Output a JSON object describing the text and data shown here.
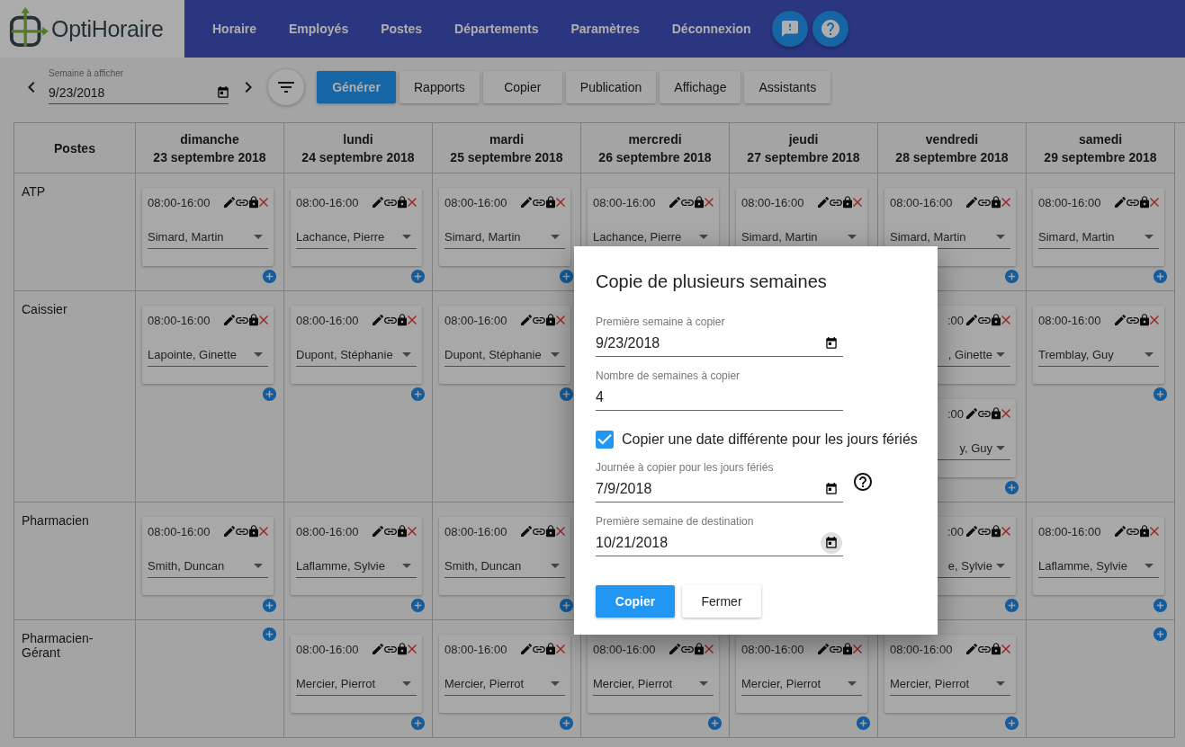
{
  "app": {
    "logo": "OptiHoraire"
  },
  "nav": [
    "Horaire",
    "Employés",
    "Postes",
    "Départements",
    "Paramètres",
    "Déconnexion"
  ],
  "week_picker": {
    "label": "Semaine à afficher",
    "value": "9/23/2018"
  },
  "actions": [
    {
      "label": "Générer",
      "primary": true
    },
    {
      "label": "Rapports",
      "primary": false
    },
    {
      "label": "Copier",
      "primary": false
    },
    {
      "label": "Publication",
      "primary": false
    },
    {
      "label": "Affichage",
      "primary": false
    },
    {
      "label": "Assistants",
      "primary": false
    }
  ],
  "schedule": {
    "corner": "Postes",
    "days": [
      {
        "name": "dimanche",
        "date": "23 septembre 2018"
      },
      {
        "name": "lundi",
        "date": "24 septembre 2018"
      },
      {
        "name": "mardi",
        "date": "25 septembre 2018"
      },
      {
        "name": "mercredi",
        "date": "26 septembre 2018"
      },
      {
        "name": "jeudi",
        "date": "27 septembre 2018"
      },
      {
        "name": "vendredi",
        "date": "28 septembre 2018"
      },
      {
        "name": "samedi",
        "date": "29 septembre 2018"
      }
    ],
    "rows": [
      {
        "post": "ATP",
        "cells": [
          {
            "add_button": true,
            "shifts": [
              {
                "time": "08:00-16:00",
                "employee": "Simard, Martin"
              }
            ]
          },
          {
            "add_button": true,
            "shifts": [
              {
                "time": "08:00-16:00",
                "employee": "Lachance, Pierre"
              }
            ]
          },
          {
            "add_button": true,
            "shifts": [
              {
                "time": "08:00-16:00",
                "employee": "Simard, Martin"
              }
            ]
          },
          {
            "shifts": [
              {
                "time": "08:00-16:00",
                "employee": "Lachance, Pierre"
              }
            ]
          },
          {
            "shifts": [
              {
                "time": "08:00-16:00",
                "employee": "Simard, Martin"
              }
            ]
          },
          {
            "add_button": true,
            "shifts": [
              {
                "time": "08:00-16:00",
                "employee": "Simard, Martin"
              }
            ]
          },
          {
            "add_button": true,
            "shifts": [
              {
                "time": "08:00-16:00",
                "employee": "Simard, Martin"
              }
            ]
          }
        ]
      },
      {
        "post": "Caissier",
        "cells": [
          {
            "add_button": true,
            "shifts": [
              {
                "time": "08:00-16:00",
                "employee": "Lapointe, Ginette"
              }
            ]
          },
          {
            "add_button": true,
            "shifts": [
              {
                "time": "08:00-16:00",
                "employee": "Dupont, Stéphanie"
              }
            ]
          },
          {
            "add_button": true,
            "shifts": [
              {
                "time": "08:00-16:00",
                "employee": "Dupont, Stéphanie"
              }
            ]
          },
          {},
          {},
          {
            "add_button": true,
            "shifts": [
              {
                "time": ":00",
                "employee": ", Ginette",
                "partly_hidden": true
              },
              {
                "time": ":00",
                "employee": "y, Guy",
                "partly_hidden": true
              }
            ]
          },
          {
            "add_button": true,
            "shifts": [
              {
                "time": "08:00-16:00",
                "employee": "Tremblay, Guy"
              }
            ]
          }
        ]
      },
      {
        "post": "Pharmacien",
        "cells": [
          {
            "add_button": true,
            "shifts": [
              {
                "time": "08:00-16:00",
                "employee": "Smith, Duncan"
              }
            ]
          },
          {
            "add_button": true,
            "shifts": [
              {
                "time": "08:00-16:00",
                "employee": "Laflamme, Sylvie"
              }
            ]
          },
          {
            "add_button": true,
            "shifts": [
              {
                "time": "08:00-16:00",
                "employee": "Smith, Duncan"
              }
            ]
          },
          {},
          {},
          {
            "add_button": true,
            "shifts": [
              {
                "time": ":00",
                "employee": "e, Sylvie",
                "partly_hidden": true
              }
            ]
          },
          {
            "add_button": true,
            "shifts": [
              {
                "time": "08:00-16:00",
                "employee": "Laflamme, Sylvie"
              }
            ]
          }
        ]
      },
      {
        "post": "Pharmacien-Gérant",
        "cells": [
          {
            "add_button": true
          },
          {
            "add_button": true,
            "shifts": [
              {
                "time": "08:00-16:00",
                "employee": "Mercier, Pierrot"
              }
            ]
          },
          {
            "add_button": true,
            "shifts": [
              {
                "time": "08:00-16:00",
                "employee": "Mercier, Pierrot"
              }
            ]
          },
          {
            "add_button": true,
            "shifts": [
              {
                "time": "08:00-16:00",
                "employee": "Mercier, Pierrot"
              }
            ]
          },
          {
            "add_button": true,
            "shifts": [
              {
                "time": "08:00-16:00",
                "employee": "Mercier, Pierrot"
              }
            ]
          },
          {
            "add_button": true,
            "shifts": [
              {
                "time": "08:00-16:00",
                "employee": "Mercier, Pierrot"
              }
            ]
          },
          {
            "add_button": true
          }
        ]
      }
    ]
  },
  "dialog": {
    "title": "Copie de plusieurs semaines",
    "fields": [
      {
        "kind": "date",
        "label": "Première semaine à copier",
        "value": "9/23/2018"
      },
      {
        "kind": "number",
        "label": "Nombre de semaines à copier",
        "value": "4"
      },
      {
        "kind": "checkbox",
        "label": "Copier une date différente pour les jours fériés",
        "checked": true
      },
      {
        "kind": "date",
        "label": "Journée à copier pour les jours fériés",
        "value": "7/9/2018",
        "help": true
      },
      {
        "kind": "date",
        "label": "Première semaine de destination",
        "value": "10/21/2018",
        "hovered": true
      }
    ],
    "buttons": [
      {
        "label": "Copier",
        "primary": true
      },
      {
        "label": "Fermer",
        "primary": false
      }
    ]
  }
}
